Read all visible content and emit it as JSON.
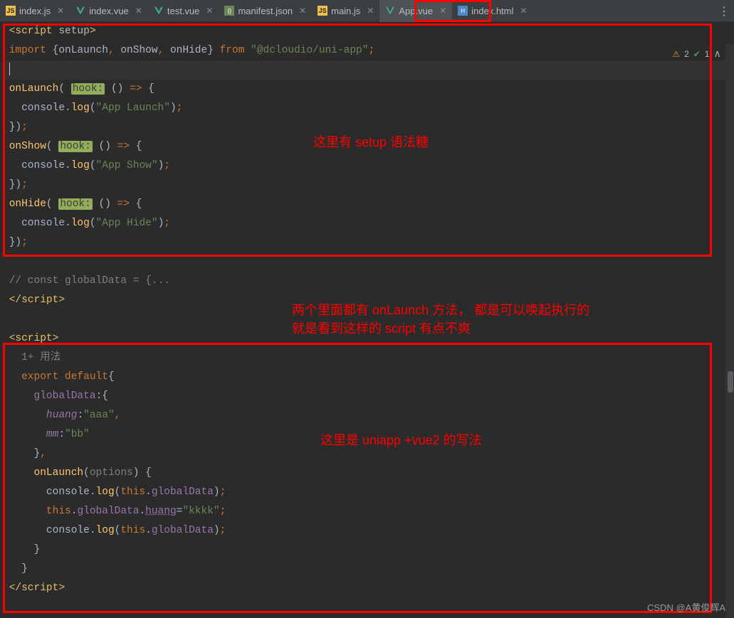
{
  "tabs": [
    {
      "icon": "js",
      "label": "index.js"
    },
    {
      "icon": "vue",
      "label": "index.vue"
    },
    {
      "icon": "vue",
      "label": "test.vue"
    },
    {
      "icon": "json",
      "label": "manifest.json"
    },
    {
      "icon": "js",
      "label": "main.js"
    },
    {
      "icon": "vue",
      "label": "App.vue",
      "active": true
    },
    {
      "icon": "html",
      "label": "index.html"
    }
  ],
  "gutter": {
    "warning_count": "2",
    "ok_count": "1"
  },
  "setup": {
    "tag_open": "script",
    "tag_attr": "setup",
    "import_kw": "import",
    "from_kw": "from",
    "pkg": "\"@dcloudio/uni-app\"",
    "hook_label": "hook:",
    "onLaunch": "onLaunch",
    "onShow": "onShow",
    "onHide": "onHide",
    "launch_msg": "\"App Launch\"",
    "show_msg": "\"App Show\"",
    "hide_msg": "\"App Hide\"",
    "console": "console",
    "log": "log",
    "comment": "// const globalData = {...",
    "annotation": "这里有 setup 语法糖"
  },
  "middle_annotation_line1": "两个里面都有 onLaunch 方法，  都是可以唤起执行的",
  "middle_annotation_line2": "就是看到这样的 script 有点不爽",
  "options": {
    "usage_hint": "1+ 用法",
    "export_kw": "export",
    "default_kw": "default",
    "globalData": "globalData",
    "huang_key": "huang",
    "huang_val": "\"aaa\"",
    "mm_key": "mm",
    "mm_val": "\"bb\"",
    "onLaunch": "onLaunch",
    "options_param": "options",
    "console": "console",
    "log": "log",
    "this_kw": "this",
    "globalData_ref": "globalData",
    "huang_ref": "huang",
    "kkkk": "\"kkkk\"",
    "annotation": "这里是 uniapp +vue2 的写法"
  },
  "watermark": "CSDN @A黄俊辉A"
}
